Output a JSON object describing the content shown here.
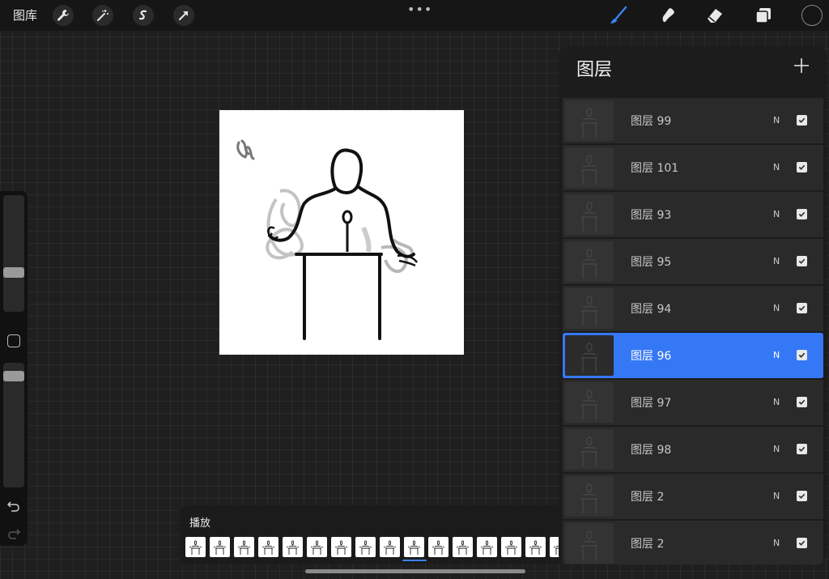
{
  "topbar": {
    "gallery_label": "图库",
    "left_tools": [
      "wrench-icon",
      "magic-wand-icon",
      "selection-icon",
      "transform-arrow-icon"
    ],
    "right_tools": [
      "brush-icon",
      "smudge-icon",
      "eraser-icon",
      "layers-icon"
    ],
    "active_tool_color": "#3b82f6",
    "current_color": "#151515"
  },
  "playback": {
    "label": "播放",
    "frame_count": 16
  },
  "layers": {
    "title": "图层",
    "items": [
      {
        "name": "图层 99",
        "mode": "N",
        "visible": true,
        "selected": false
      },
      {
        "name": "图层 101",
        "mode": "N",
        "visible": true,
        "selected": false
      },
      {
        "name": "图层 93",
        "mode": "N",
        "visible": true,
        "selected": false
      },
      {
        "name": "图层 95",
        "mode": "N",
        "visible": true,
        "selected": false
      },
      {
        "name": "图层 94",
        "mode": "N",
        "visible": true,
        "selected": false
      },
      {
        "name": "图层 96",
        "mode": "N",
        "visible": true,
        "selected": true
      },
      {
        "name": "图层 97",
        "mode": "N",
        "visible": true,
        "selected": false
      },
      {
        "name": "图层 98",
        "mode": "N",
        "visible": true,
        "selected": false
      },
      {
        "name": "图层 2",
        "mode": "N",
        "visible": true,
        "selected": false
      },
      {
        "name": "图层 2",
        "mode": "N",
        "visible": true,
        "selected": false
      }
    ]
  },
  "sidebar": {
    "brush_size": 0.7,
    "brush_opacity": 0.9
  }
}
